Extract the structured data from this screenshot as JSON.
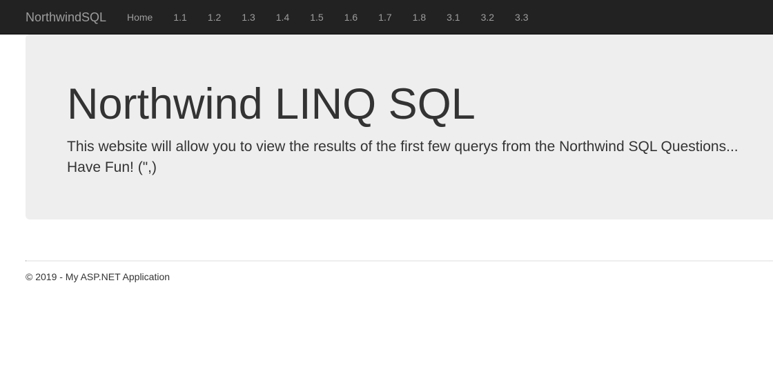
{
  "navbar": {
    "brand": "NorthwindSQL",
    "links": [
      {
        "label": "Home"
      },
      {
        "label": "1.1"
      },
      {
        "label": "1.2"
      },
      {
        "label": "1.3"
      },
      {
        "label": "1.4"
      },
      {
        "label": "1.5"
      },
      {
        "label": "1.6"
      },
      {
        "label": "1.7"
      },
      {
        "label": "1.8"
      },
      {
        "label": "3.1"
      },
      {
        "label": "3.2"
      },
      {
        "label": "3.3"
      }
    ]
  },
  "hero": {
    "title": "Northwind LINQ SQL",
    "lead": "This website will allow you to view the results of the first few querys from the Northwind SQL Questions... Have Fun! (\",)"
  },
  "footer": {
    "text": "© 2019 - My ASP.NET Application"
  },
  "colors": {
    "navbar_bg": "#222222",
    "navbar_text": "#9d9d9d",
    "jumbotron_bg": "#eeeeee",
    "body_text": "#333333"
  }
}
